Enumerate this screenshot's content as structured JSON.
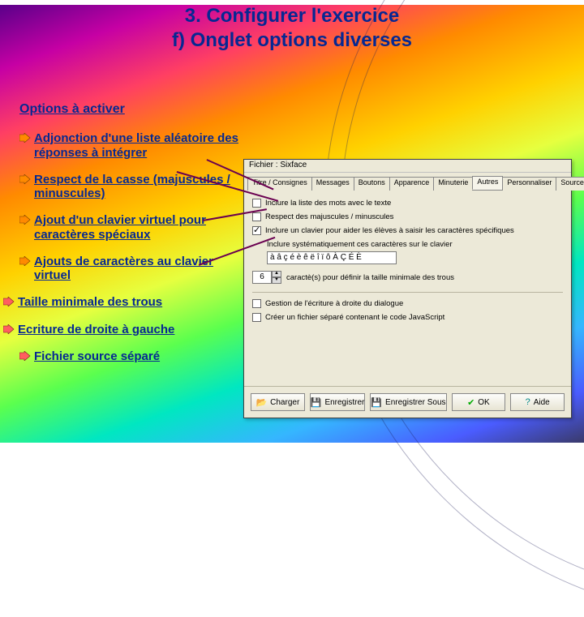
{
  "title_line1": "3. Configurer l'exercice",
  "title_line2": "f) Onglet options diverses",
  "section_label": "Options à activer",
  "bullets": [
    "Adjonction d'une liste aléatoire des réponses à intégrer",
    "Respect de la casse (majuscules / minuscules)",
    "Ajout d'un clavier virtuel pour caractères spéciaux",
    "Ajouts de caractères au clavier virtuel",
    "Taille minimale des trous",
    "Ecriture de droite à gauche",
    "Fichier source séparé"
  ],
  "dialog": {
    "caption": "Fichier : Sixface",
    "tabs": [
      "Titre / Consignes",
      "Messages",
      "Boutons",
      "Apparence",
      "Minuterie",
      "Autres",
      "Personnaliser",
      "Source"
    ],
    "active_tab": 5,
    "checks": [
      {
        "label": "Inclure la liste des mots avec le texte",
        "checked": false
      },
      {
        "label": "Respect des majuscules / minuscules",
        "checked": false
      },
      {
        "label": "Inclure un clavier pour aider les élèves à saisir les caractères spécifiques",
        "checked": true
      }
    ],
    "keypad_sublabel": "Inclure systématiquement ces caractères sur le clavier",
    "keypad_value": "à â ç é è ê ë î ï ô À Ç É È",
    "spin_label": "caractè(s) pour définir la taille minimale des trous",
    "spin_value": "6",
    "rtl": {
      "label": "Gestion de l'écriture à droite du dialogue",
      "checked": false
    },
    "sepsrc": {
      "label": "Créer un fichier séparé contenant le code JavaScript",
      "checked": false
    },
    "buttons": {
      "load": "Charger",
      "save": "Enregistrer",
      "saveas": "Enregistrer Sous",
      "ok": "OK",
      "help": "Aide"
    }
  }
}
